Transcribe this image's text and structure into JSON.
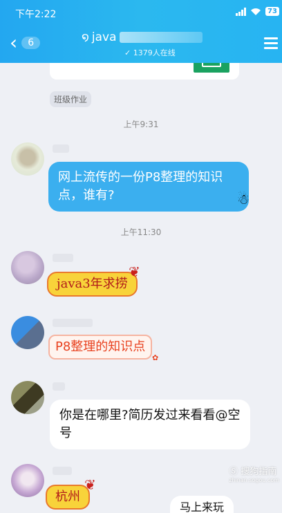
{
  "status_bar": {
    "time": "下午2:22",
    "battery": "73"
  },
  "header": {
    "back_count": "6",
    "title_visible": "java",
    "online_text": "1379人在线"
  },
  "chat": {
    "tag": "班级作业",
    "time_1": "上午9:31",
    "time_2": "上午11:30",
    "messages": [
      {
        "text": "网上流传的一份P8整理的知识点，谁有?"
      },
      {
        "text": "java3年求捞"
      },
      {
        "text": "P8整理的知识点"
      },
      {
        "text": "你是在哪里?简历发过来看看@空号"
      },
      {
        "text": "杭州"
      },
      {
        "text": "马上来玩"
      }
    ]
  },
  "watermark": {
    "brand": "搜狗指南",
    "site": "zhinan.sogou.com"
  }
}
